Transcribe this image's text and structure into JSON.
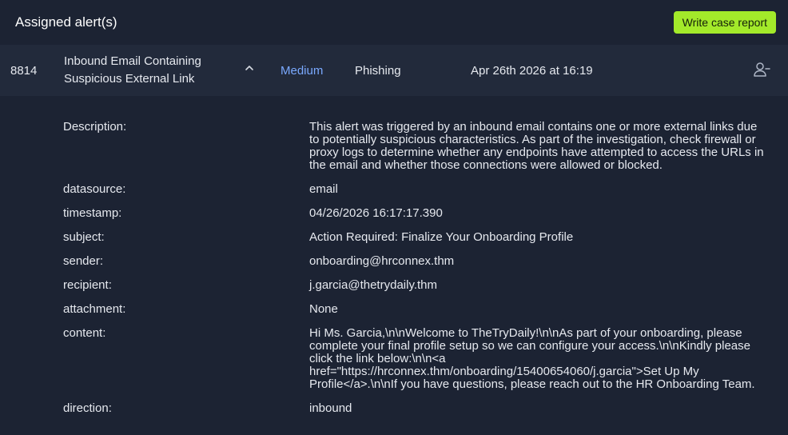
{
  "header": {
    "title": "Assigned alert(s)",
    "report_button": "Write case report"
  },
  "alert": {
    "id": "8814",
    "title": "Inbound Email Containing Suspicious External Link",
    "severity": "Medium",
    "category": "Phishing",
    "timestamp": "Apr 26th 2026 at 16:19"
  },
  "details": [
    {
      "label": "Description:",
      "value": "This alert was triggered by an inbound email contains one or more external links due to potentially suspicious characteristics. As part of the investigation, check firewall or proxy logs to determine whether any endpoints have attempted to access the URLs in the email and whether those connections were allowed or blocked."
    },
    {
      "label": "datasource:",
      "value": "email"
    },
    {
      "label": "timestamp:",
      "value": "04/26/2026 16:17:17.390"
    },
    {
      "label": "subject:",
      "value": "Action Required: Finalize Your Onboarding Profile"
    },
    {
      "label": "sender:",
      "value": "onboarding@hrconnex.thm"
    },
    {
      "label": "recipient:",
      "value": "j.garcia@thetrydaily.thm"
    },
    {
      "label": "attachment:",
      "value": "None"
    },
    {
      "label": "content:",
      "value": "Hi Ms. Garcia,\\n\\nWelcome to TheTryDaily!\\n\\nAs part of your onboarding, please complete your final profile setup so we can configure your access.\\n\\nKindly please click the link below:\\n\\n<a href=\"https://hrconnex.thm/onboarding/15400654060/j.garcia\">Set Up My Profile</a>.\\n\\nIf you have questions, please reach out to the HR Onboarding Team."
    },
    {
      "label": "direction:",
      "value": "inbound"
    }
  ],
  "icons": {
    "chevron": "chevron-up-icon",
    "assign": "user-minus-icon"
  },
  "colors": {
    "background": "#1c2333",
    "row_background": "#222a3b",
    "accent_button": "#a3ea2a",
    "severity_medium": "#7aa9ff"
  }
}
